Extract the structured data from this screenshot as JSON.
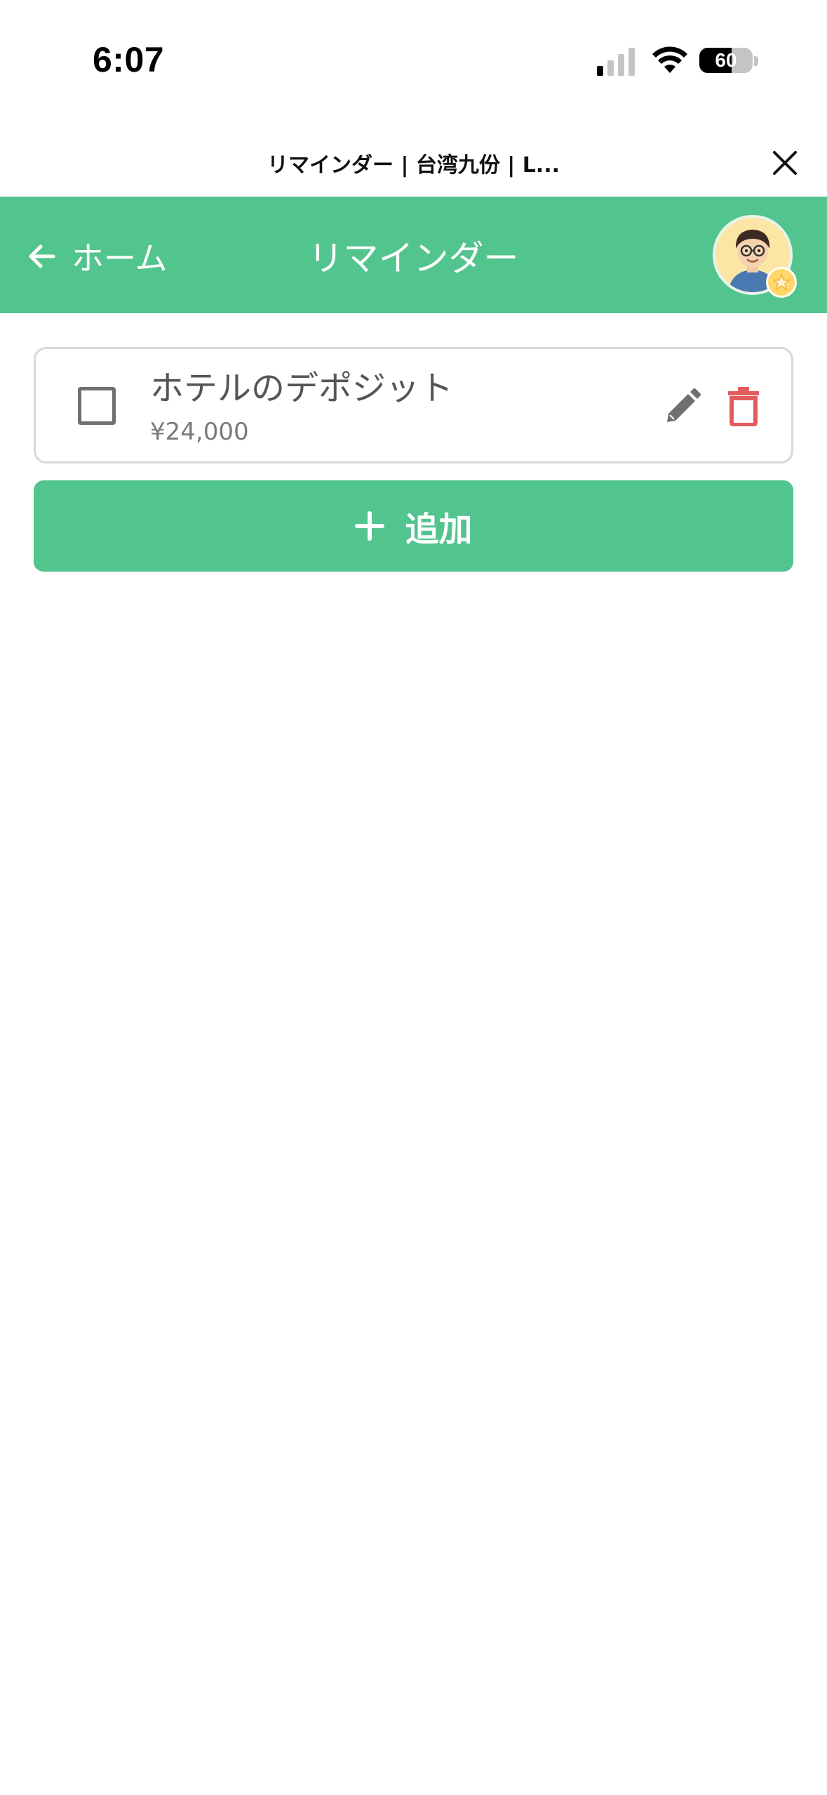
{
  "status_bar": {
    "time": "6:07",
    "battery_level": "60",
    "signal_bars_active": 1,
    "signal_bars_total": 4
  },
  "browser": {
    "title": "リマインダー | 台湾九份 | L..."
  },
  "header": {
    "back_label": "ホーム",
    "title": "リマインダー"
  },
  "reminders": [
    {
      "title": "ホテルのデポジット",
      "amount": "¥24,000",
      "checked": false
    }
  ],
  "add_button": {
    "label": "追加"
  },
  "colors": {
    "accent": "#52c48d",
    "delete": "#e25c5c",
    "edit": "#707070"
  },
  "icons": {
    "close": "close-icon",
    "back": "arrow-left-icon",
    "edit": "pencil-icon",
    "delete": "trash-icon",
    "add": "plus-icon",
    "badge": "star-badge-icon"
  }
}
